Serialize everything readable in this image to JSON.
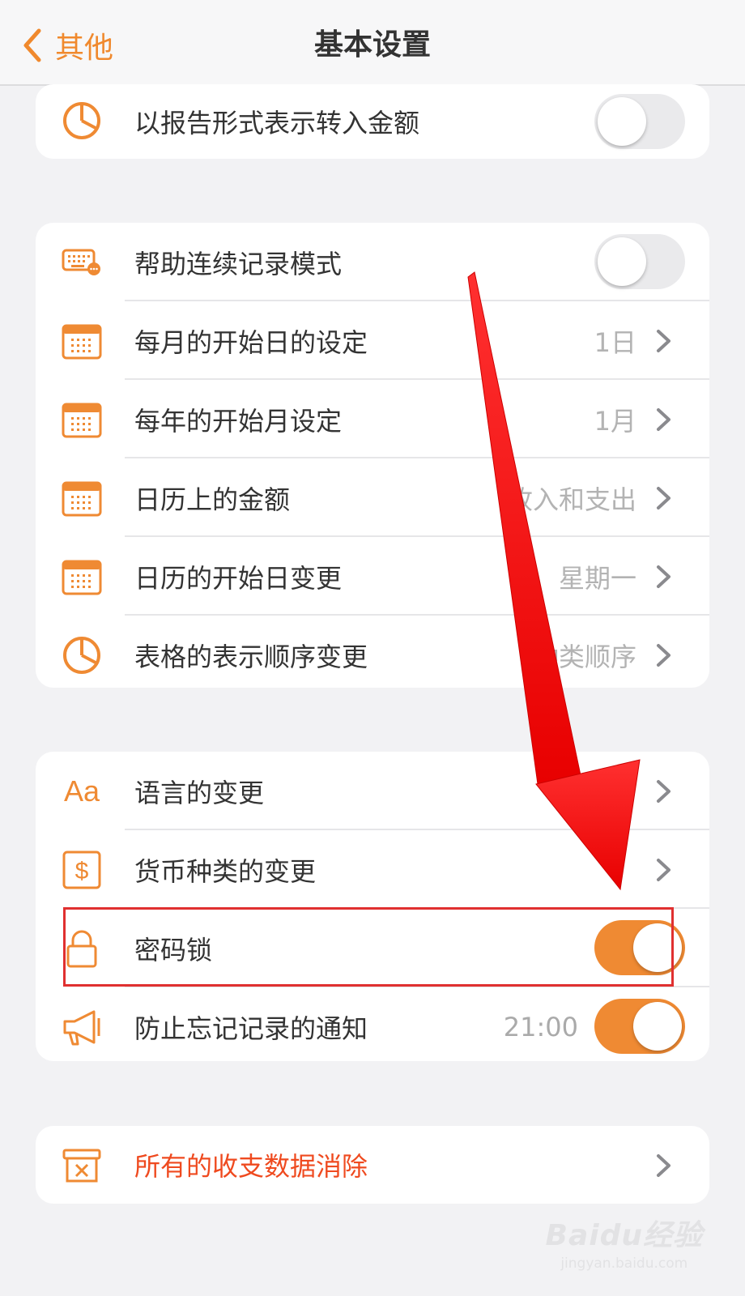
{
  "nav": {
    "back_label": "其他",
    "title": "基本设置"
  },
  "colors": {
    "accent": "#ef8a33",
    "danger": "#ef4a1f",
    "highlight": "#e03030",
    "arrow": "#ff1010"
  },
  "section1": {
    "items": [
      {
        "label": "以报告形式表示转入金额",
        "icon": "pie-chart-icon",
        "toggle": false
      }
    ]
  },
  "section2": {
    "items": [
      {
        "label": "帮助连续记录模式",
        "icon": "keyboard-icon",
        "toggle": false
      },
      {
        "label": "每月的开始日的设定",
        "icon": "calendar-icon",
        "value": "1日"
      },
      {
        "label": "每年的开始月设定",
        "icon": "calendar-icon",
        "value": "1月"
      },
      {
        "label": "日历上的金额",
        "icon": "calendar-icon",
        "value": "收入和支出"
      },
      {
        "label": "日历的开始日变更",
        "icon": "calendar-icon",
        "value": "星期一"
      },
      {
        "label": "表格的表示顺序变更",
        "icon": "pie-chart-icon",
        "value": "种类顺序"
      }
    ]
  },
  "section3": {
    "items": [
      {
        "label": "语言的变更",
        "icon": "language-icon"
      },
      {
        "label": "货币种类的变更",
        "icon": "dollar-icon"
      },
      {
        "label": "密码锁",
        "icon": "lock-icon",
        "toggle": true
      },
      {
        "label": "防止忘记记录的通知",
        "icon": "megaphone-icon",
        "value": "21:00",
        "toggle": true
      }
    ]
  },
  "section4": {
    "items": [
      {
        "label": "所有的收支数据消除",
        "icon": "trash-box-icon"
      }
    ]
  },
  "watermark": {
    "brand": "Baidu经验",
    "url": "jingyan.baidu.com"
  }
}
